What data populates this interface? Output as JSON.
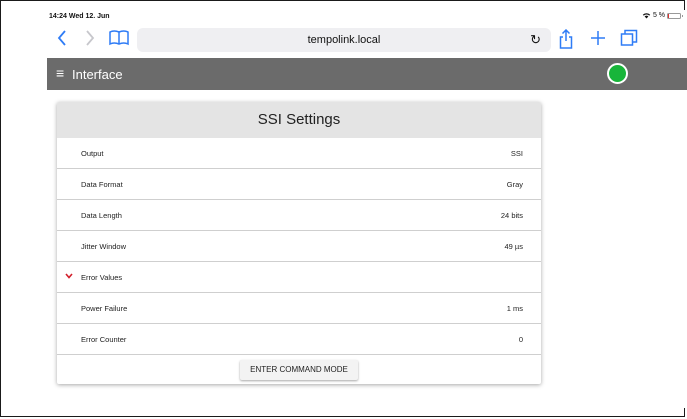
{
  "status": {
    "time": "14:24  Wed 12. Jun",
    "battery": "5 %",
    "battery_level": 0.05
  },
  "browser": {
    "url": "tempolink.local"
  },
  "app": {
    "title": "Interface",
    "connection_color": "#18b53a"
  },
  "card": {
    "title": "SSI Settings",
    "rows": [
      {
        "label": "Output",
        "value": "SSI"
      },
      {
        "label": "Data Format",
        "value": "Gray"
      },
      {
        "label": "Data Length",
        "value": "24 bits"
      },
      {
        "label": "Jitter Window",
        "value": "49 µs"
      },
      {
        "label": "Error Values",
        "value": ""
      },
      {
        "label": "Power Failure",
        "value": "1 ms"
      },
      {
        "label": "Error Counter",
        "value": "0"
      }
    ],
    "command_button": "ENTER COMMAND MODE"
  }
}
